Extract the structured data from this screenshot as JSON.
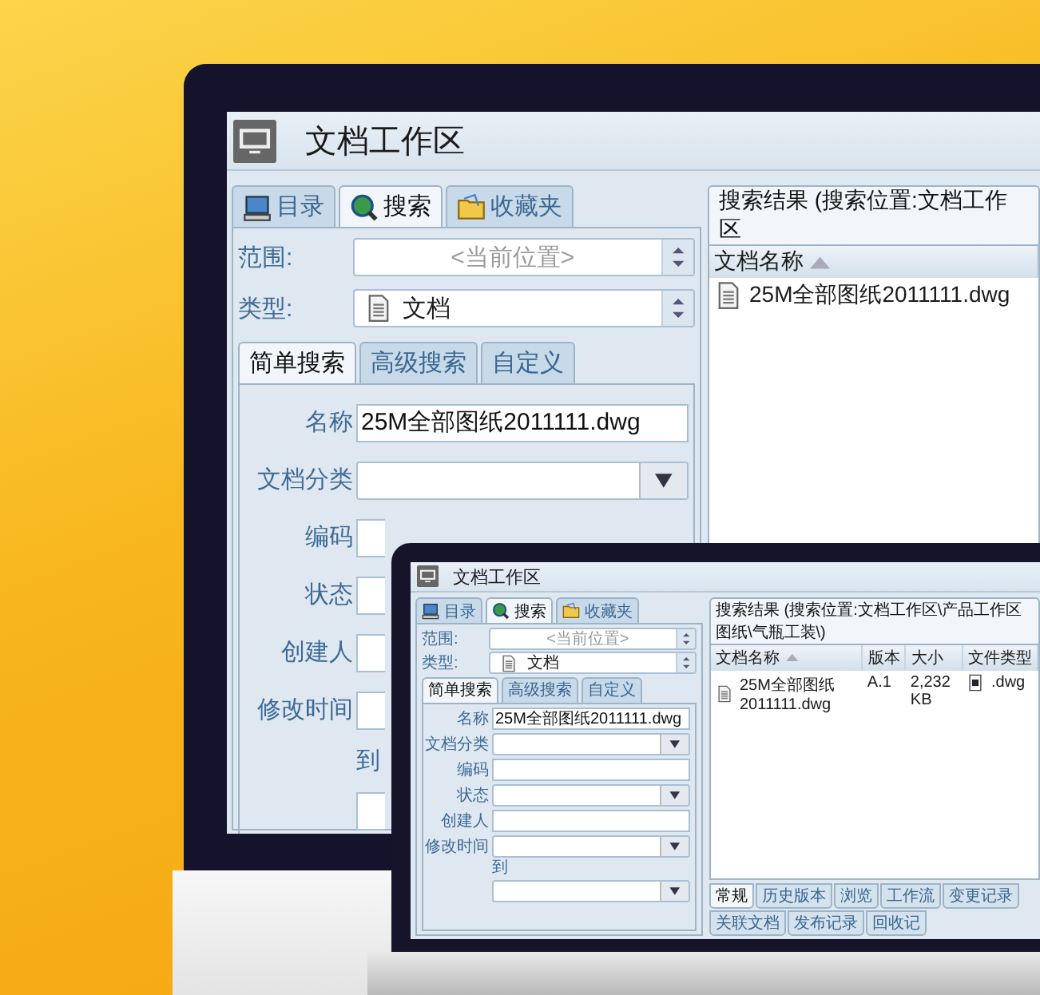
{
  "main_window": {
    "title": "文档工作区",
    "nav_tabs": [
      {
        "label": "目录",
        "kind": "directory",
        "selected": false
      },
      {
        "label": "搜索",
        "kind": "search",
        "selected": true
      },
      {
        "label": "收藏夹",
        "kind": "favorites",
        "selected": false
      }
    ],
    "scope": {
      "label": "范围:",
      "placeholder": "<当前位置>"
    },
    "type": {
      "label": "类型:",
      "value": "文档"
    },
    "search_tabs": [
      {
        "label": "简单搜索",
        "selected": true
      },
      {
        "label": "高级搜索",
        "selected": false
      },
      {
        "label": "自定义",
        "selected": false
      }
    ],
    "fields": [
      {
        "label": "名称",
        "kind": "text",
        "value": "25M全部图纸2011111.dwg"
      },
      {
        "label": "文档分类",
        "kind": "dropdown"
      },
      {
        "label": "编码",
        "kind": "covered"
      },
      {
        "label": "状态",
        "kind": "covered"
      },
      {
        "label": "创建人",
        "kind": "covered"
      },
      {
        "label": "修改时间",
        "kind": "covered_range",
        "to_label": "到"
      }
    ],
    "results": {
      "title": "搜索结果 (搜索位置:文档工作区",
      "columns": [
        {
          "label": "文档名称",
          "sorted": true
        }
      ],
      "rows": [
        {
          "cells": [
            {
              "text": "25M全部图纸2011111.dwg",
              "kind": "file"
            }
          ]
        }
      ]
    }
  },
  "laptop_window": {
    "title": "文档工作区",
    "nav_tabs": [
      {
        "label": "目录",
        "kind": "directory",
        "selected": false
      },
      {
        "label": "搜索",
        "kind": "search",
        "selected": true
      },
      {
        "label": "收藏夹",
        "kind": "favorites",
        "selected": false
      }
    ],
    "scope": {
      "label": "范围:",
      "placeholder": "<当前位置>"
    },
    "type": {
      "label": "类型:",
      "value": "文档"
    },
    "search_tabs": [
      {
        "label": "简单搜索",
        "selected": true
      },
      {
        "label": "高级搜索",
        "selected": false
      },
      {
        "label": "自定义",
        "selected": false
      }
    ],
    "fields": [
      {
        "label": "名称",
        "kind": "text",
        "value": "25M全部图纸2011111.dwg"
      },
      {
        "label": "文档分类",
        "kind": "dropdown"
      },
      {
        "label": "编码",
        "kind": "text"
      },
      {
        "label": "状态",
        "kind": "dropdown"
      },
      {
        "label": "创建人",
        "kind": "text"
      },
      {
        "label": "修改时间",
        "kind": "range",
        "to_label": "到"
      }
    ],
    "results": {
      "title": "搜索结果 (搜索位置:文档工作区\\产品工作区图纸\\气瓶工装\\)",
      "columns": [
        {
          "label": "文档名称",
          "sorted": true
        },
        {
          "label": "版本",
          "sorted": false
        },
        {
          "label": "大小",
          "sorted": false
        },
        {
          "label": "文件类型",
          "sorted": false
        }
      ],
      "rows": [
        {
          "cells": [
            {
              "text": "25M全部图纸2011111.dwg",
              "kind": "file"
            },
            {
              "text": "A.1",
              "kind": "plain"
            },
            {
              "text": "2,232 KB",
              "kind": "plain"
            },
            {
              "text": ".dwg",
              "kind": "type"
            }
          ]
        }
      ]
    },
    "bottom_tabs": [
      {
        "label": "常规",
        "selected": true
      },
      {
        "label": "历史版本",
        "selected": false
      },
      {
        "label": "浏览",
        "selected": false
      },
      {
        "label": "工作流",
        "selected": false
      },
      {
        "label": "变更记录",
        "selected": false
      },
      {
        "label": "关联文档",
        "selected": false
      },
      {
        "label": "发布记录",
        "selected": false
      },
      {
        "label": "回收记",
        "selected": false
      }
    ]
  }
}
